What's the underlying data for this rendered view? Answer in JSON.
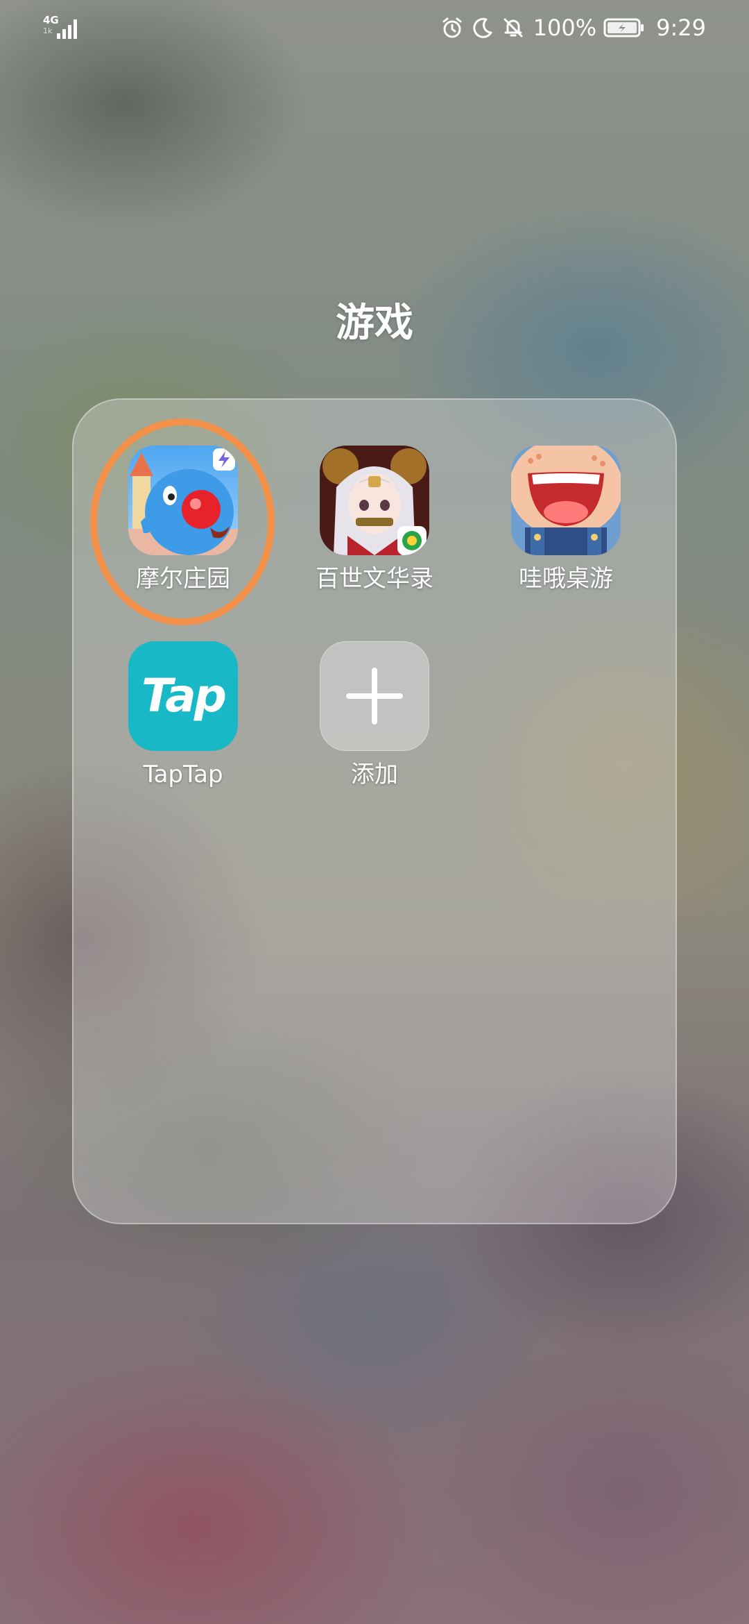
{
  "status_bar": {
    "network": "4G",
    "network_sub": "1k",
    "battery_percent": "100%",
    "time": "9:29",
    "icons": [
      "alarm-icon",
      "moon-icon",
      "bell-off-icon",
      "battery-charging-icon"
    ]
  },
  "folder": {
    "title": "游戏",
    "apps": [
      {
        "label": "摩尔庄园",
        "icon": "mole-manor-app-icon"
      },
      {
        "label": "百世文华录",
        "icon": "baishi-wenhualu-app-icon"
      },
      {
        "label": "哇哦桌游",
        "icon": "wawo-boardgame-app-icon"
      },
      {
        "label": "TapTap",
        "icon": "taptap-app-icon",
        "icon_text": "Tap"
      },
      {
        "label": "添加",
        "icon": "plus-icon"
      }
    ]
  },
  "colors": {
    "highlight_ring": "#f3914a",
    "taptap_bg": "#18b8c6"
  }
}
